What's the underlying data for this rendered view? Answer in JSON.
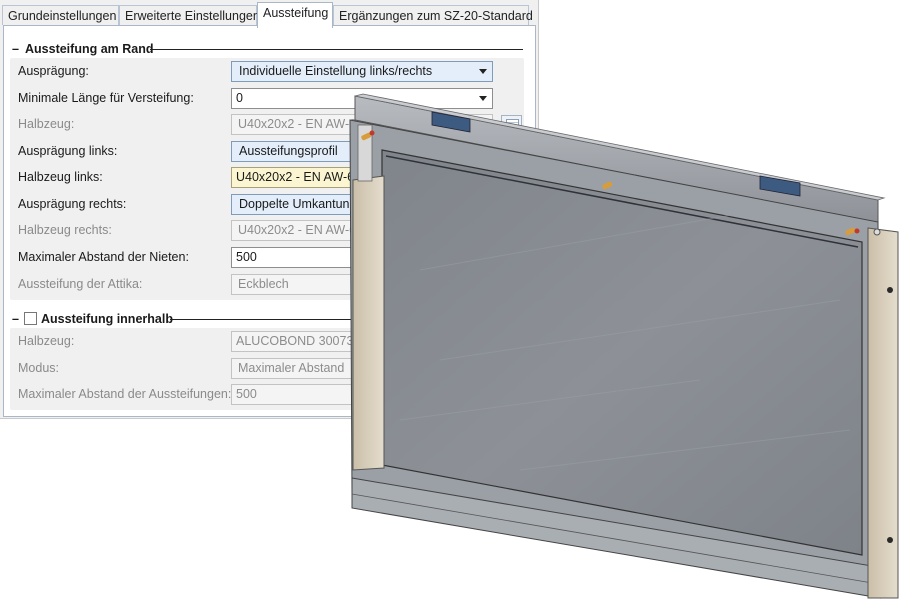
{
  "tabs": [
    {
      "label": "Grundeinstellungen"
    },
    {
      "label": "Erweiterte Einstellungen"
    },
    {
      "label": "Aussteifung"
    },
    {
      "label": "Ergänzungen zum SZ-20-Standard"
    }
  ],
  "active_tab": "Aussteifung",
  "rand": {
    "heading": "Aussteifung am Rand",
    "rows": [
      {
        "label": "Ausprägung:",
        "value": "Individuelle Einstellung links/rechts"
      },
      {
        "label": "Minimale Länge für Versteifung:",
        "value": "0"
      },
      {
        "label": "Halbzeug:",
        "value": "U40x20x2 - EN AW-60"
      },
      {
        "label": "Ausprägung links:",
        "value": "Aussteifungsprofil"
      },
      {
        "label": "Halbzeug links:",
        "value": "U40x20x2 - EN AW-60"
      },
      {
        "label": "Ausprägung rechts:",
        "value": "Doppelte Umkantung"
      },
      {
        "label": "Halbzeug rechts:",
        "value": "U40x20x2 - EN AW-60"
      },
      {
        "label": "Maximaler Abstand der Nieten:",
        "value": "500"
      },
      {
        "label": "Aussteifung der Attika:",
        "value": "Eckblech"
      }
    ]
  },
  "innerhalb": {
    "heading": "Aussteifung innerhalb",
    "checked": false,
    "rows": [
      {
        "label": "Halbzeug:",
        "value": "ALUCOBOND 30073 -"
      },
      {
        "label": "Modus:",
        "value": "Maximaler Abstand"
      },
      {
        "label": "Maximaler Abstand der Aussteifungen:",
        "value": "500"
      }
    ]
  },
  "colors": {
    "panel_frame": "#9aa0a6",
    "glass": "#8a8f95",
    "profile_beige": "#d8cfbe",
    "clip_blue": "#3d5b80",
    "dropdown_selected": "#e4eefb",
    "highlight_field": "#fbf6d1"
  }
}
